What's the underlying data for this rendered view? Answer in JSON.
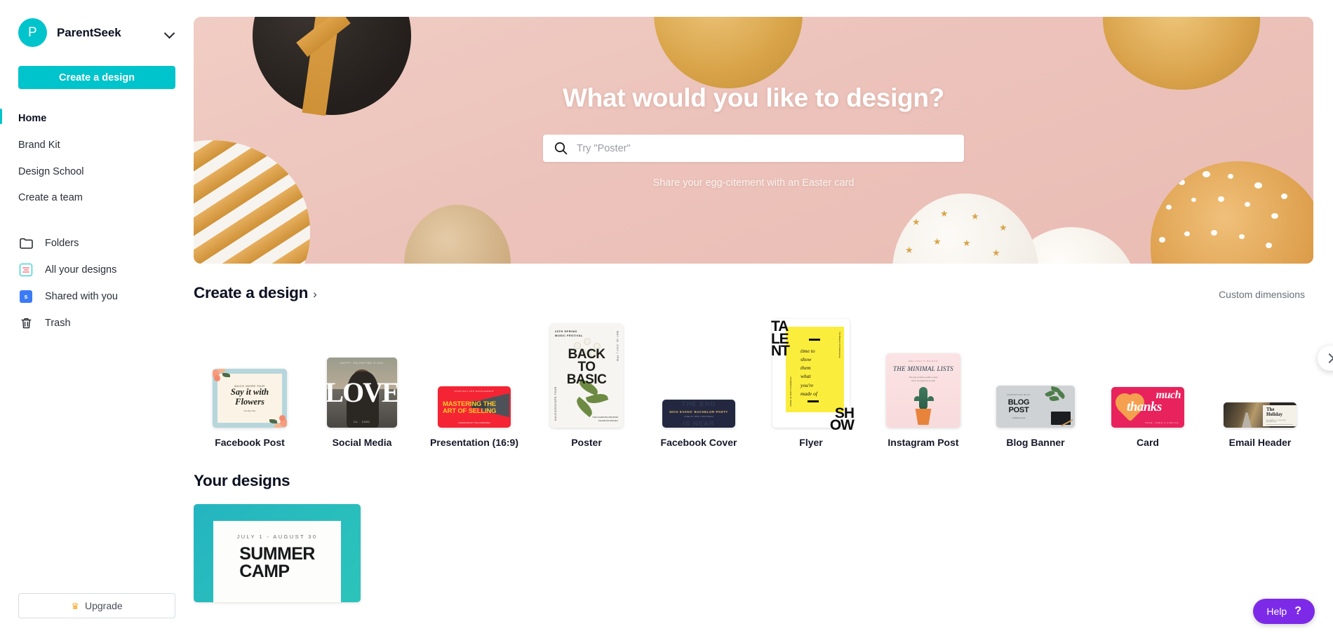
{
  "sidebar": {
    "brand": {
      "initial": "P",
      "name": "ParentSeek",
      "chevron_icon": "chevron-down-icon"
    },
    "create_button": "Create a design",
    "nav_top": [
      {
        "label": "Home",
        "active": true
      },
      {
        "label": "Brand Kit",
        "active": false
      },
      {
        "label": "Design School",
        "active": false
      },
      {
        "label": "Create a team",
        "active": false
      }
    ],
    "nav_items": [
      {
        "label": "Folders",
        "icon": "folder-icon"
      },
      {
        "label": "All your designs",
        "icon": "designs-icon"
      },
      {
        "label": "Shared with you",
        "icon": "shared-icon",
        "badge": "s"
      },
      {
        "label": "Trash",
        "icon": "trash-icon"
      }
    ],
    "upgrade": {
      "label": "Upgrade",
      "icon": "crown-icon"
    }
  },
  "hero": {
    "title": "What would you like to design?",
    "search_placeholder": "Try \"Poster\"",
    "search_value": "",
    "search_icon": "search-icon",
    "subtitle": "Share your egg-citement with an Easter card",
    "background_color": "#ecc3bb"
  },
  "create_section": {
    "title": "Create a design",
    "caret": "›",
    "custom_dimensions": "Custom dimensions",
    "next_arrow_icon": "chevron-right-icon",
    "cards": [
      {
        "label": "Facebook Post",
        "art": {
          "kicker": "MUCH MORE FAIR",
          "title_line1": "Say it with",
          "title_line2": "Flowers",
          "sub": "THIS Sunday, We Of Day, Is Offered by\\nYvonne Rovers Co."
        }
      },
      {
        "label": "Social Media",
        "art": {
          "top": "HAPPY VALENTINE'S DAY",
          "word": "LOVE",
          "bottom": "CL . 2391"
        }
      },
      {
        "label": "Presentation (16:9)",
        "art": {
          "kicker": "STRATEGY AND MANAGEMENT",
          "line1": "MASTERING THE",
          "line2": "ART OF SELLING",
          "footer": "PRESENTED BY: THE COMPANIES\\nMARCH 09 2019"
        }
      },
      {
        "label": "Poster",
        "art": {
          "kicker": "20TH SPRING\\nMUSIC FESTIVAL",
          "big": "BACK\\nTO\\nBASIC",
          "right_vertical": "MAY 18, 2020 | 7PM",
          "left_vertical": "KALEIDOSCOPE TOUR\\nLIVE IN MANILA",
          "footer": "THE KALEIDOSCOPE BAND\\nKALEIDOSCOPE.NET"
        }
      },
      {
        "label": "Facebook Cover",
        "art": {
          "ghost_top": "THE END",
          "main": "NICK EVANS' BACHELOR PARTY",
          "sub": "JUNE 22 | 8PM | THE BLUE CLUB | SAN DIEGO",
          "ghost_bottom": "IS NEAR"
        }
      },
      {
        "label": "Flyer",
        "art": {
          "word1": "TA\\nLE\\nNT",
          "word2": "SH\\nOW",
          "middle": "time to\\nshow\\nthem\\nwhat\\nyou're\\nmade of",
          "right_vertical": "The Museum of Contemporary presents",
          "left_vertical": "October 23, 2019 | The Auditorium"
        }
      },
      {
        "label": "Instagram Post",
        "art": {
          "kicker": "MELISSA'S BOOKS",
          "title": "THE MINIMAL LISTS",
          "sub": "The way to clean up after a need\\nmore. So simple as an aide"
        }
      },
      {
        "label": "Blog Banner",
        "art": {
          "kicker": "INSPIRATION BLOG",
          "line1": "BLOG",
          "line2": "POST",
          "sub": "by Michael Jones, 28 October"
        }
      },
      {
        "label": "Card",
        "art": {
          "word1": "much",
          "word2": "thanks",
          "from": "FROM: JAMIE & CAMILLE"
        }
      },
      {
        "label": "Email Header",
        "art": {
          "title": "The\\nHoliday",
          "sub": "A GREAT & LEISURE MAGAZINE"
        }
      }
    ]
  },
  "your_designs": {
    "title": "Your designs",
    "items": [
      {
        "kicker": "JULY 1 - AUGUST 30",
        "title_line1": "SUMMER",
        "title_line2": "CAMP"
      }
    ]
  },
  "help": {
    "label": "Help",
    "mark": "?",
    "color": "#7d2ae8"
  }
}
